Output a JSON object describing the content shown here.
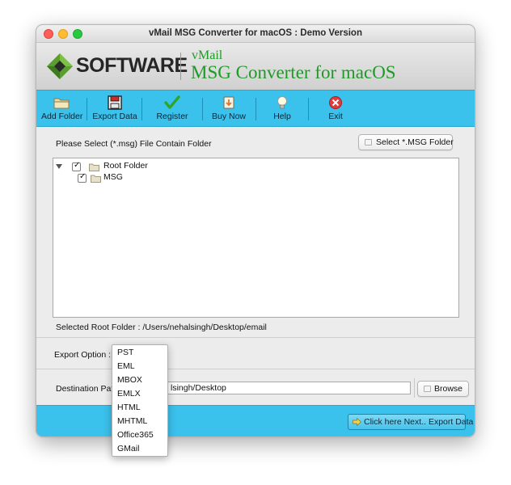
{
  "window": {
    "title": "vMail MSG Converter for macOS : Demo Version"
  },
  "banner": {
    "logo_text": "SOFTWARE",
    "product_line1": "vMail",
    "product_line2": "MSG Converter for macOS",
    "brand_colors": {
      "green": "#1f9a26",
      "dark": "#262626"
    }
  },
  "toolbar": {
    "color": "#3ac1ec",
    "buttons": [
      {
        "label": "Add Folder",
        "icon": "folder-icon"
      },
      {
        "label": "Export Data",
        "icon": "save-icon"
      },
      {
        "label": "Register",
        "icon": "checkmark-icon"
      },
      {
        "label": "Buy Now",
        "icon": "buy-icon"
      },
      {
        "label": "Help",
        "icon": "lightbulb-icon"
      },
      {
        "label": "Exit",
        "icon": "exit-icon"
      }
    ]
  },
  "source": {
    "instruction": "Please Select (*.msg) File Contain Folder",
    "select_button": "Select *.MSG Folder",
    "tree": [
      {
        "label": "Root Folder",
        "checked": true,
        "expanded": true,
        "level": 0
      },
      {
        "label": "MSG",
        "checked": true,
        "level": 1
      }
    ],
    "selected_root_label": "Selected Root Folder : /Users/nehalsingh/Desktop/email"
  },
  "export": {
    "label": "Export Option :",
    "options": [
      "PST",
      "EML",
      "MBOX",
      "EMLX",
      "HTML",
      "MHTML",
      "Office365",
      "GMail"
    ]
  },
  "destination": {
    "label": "Destination Path",
    "value": "lsingh/Desktop",
    "browse_button": "Browse"
  },
  "footer": {
    "next_button": "Click here Next.. Export Data"
  }
}
